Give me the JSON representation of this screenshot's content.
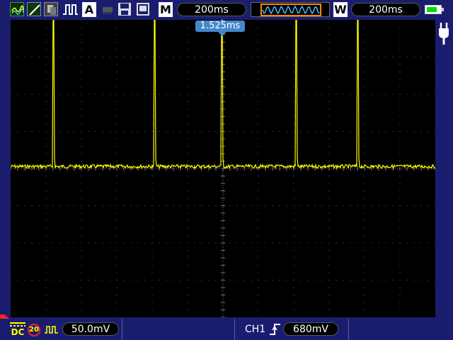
{
  "top": {
    "math_tag": "M",
    "timebase": "200ms",
    "window_tag": "W",
    "window_timebase": "200ms",
    "auto_label": "A"
  },
  "cursor": {
    "time_label": "1.525ms"
  },
  "bottom": {
    "coupling": "DC",
    "bw_limit": "20",
    "volts_per_div": "50.0mV",
    "trigger_source": "CH1",
    "trigger_level": "680mV"
  },
  "trace": {
    "color": "#ffff00",
    "grid": true,
    "pulse_count": 5
  },
  "colors": {
    "trace": "#ffff00",
    "background": "#1a1d6e",
    "screen": "#000000",
    "cursor_label": "#4488cc",
    "battery": "#00dd00",
    "ground_marker": "#ff2020"
  },
  "icons": [
    "waveform-icon",
    "ramp-icon",
    "persistence-icon",
    "pulse-icon",
    "auto-icon",
    "chip-icon",
    "save-icon",
    "screen-icon",
    "window-waveform-icon",
    "battery-icon",
    "power-plug-icon",
    "trigger-edge-icon",
    "ground-marker-icon",
    "square-wave-icon"
  ]
}
